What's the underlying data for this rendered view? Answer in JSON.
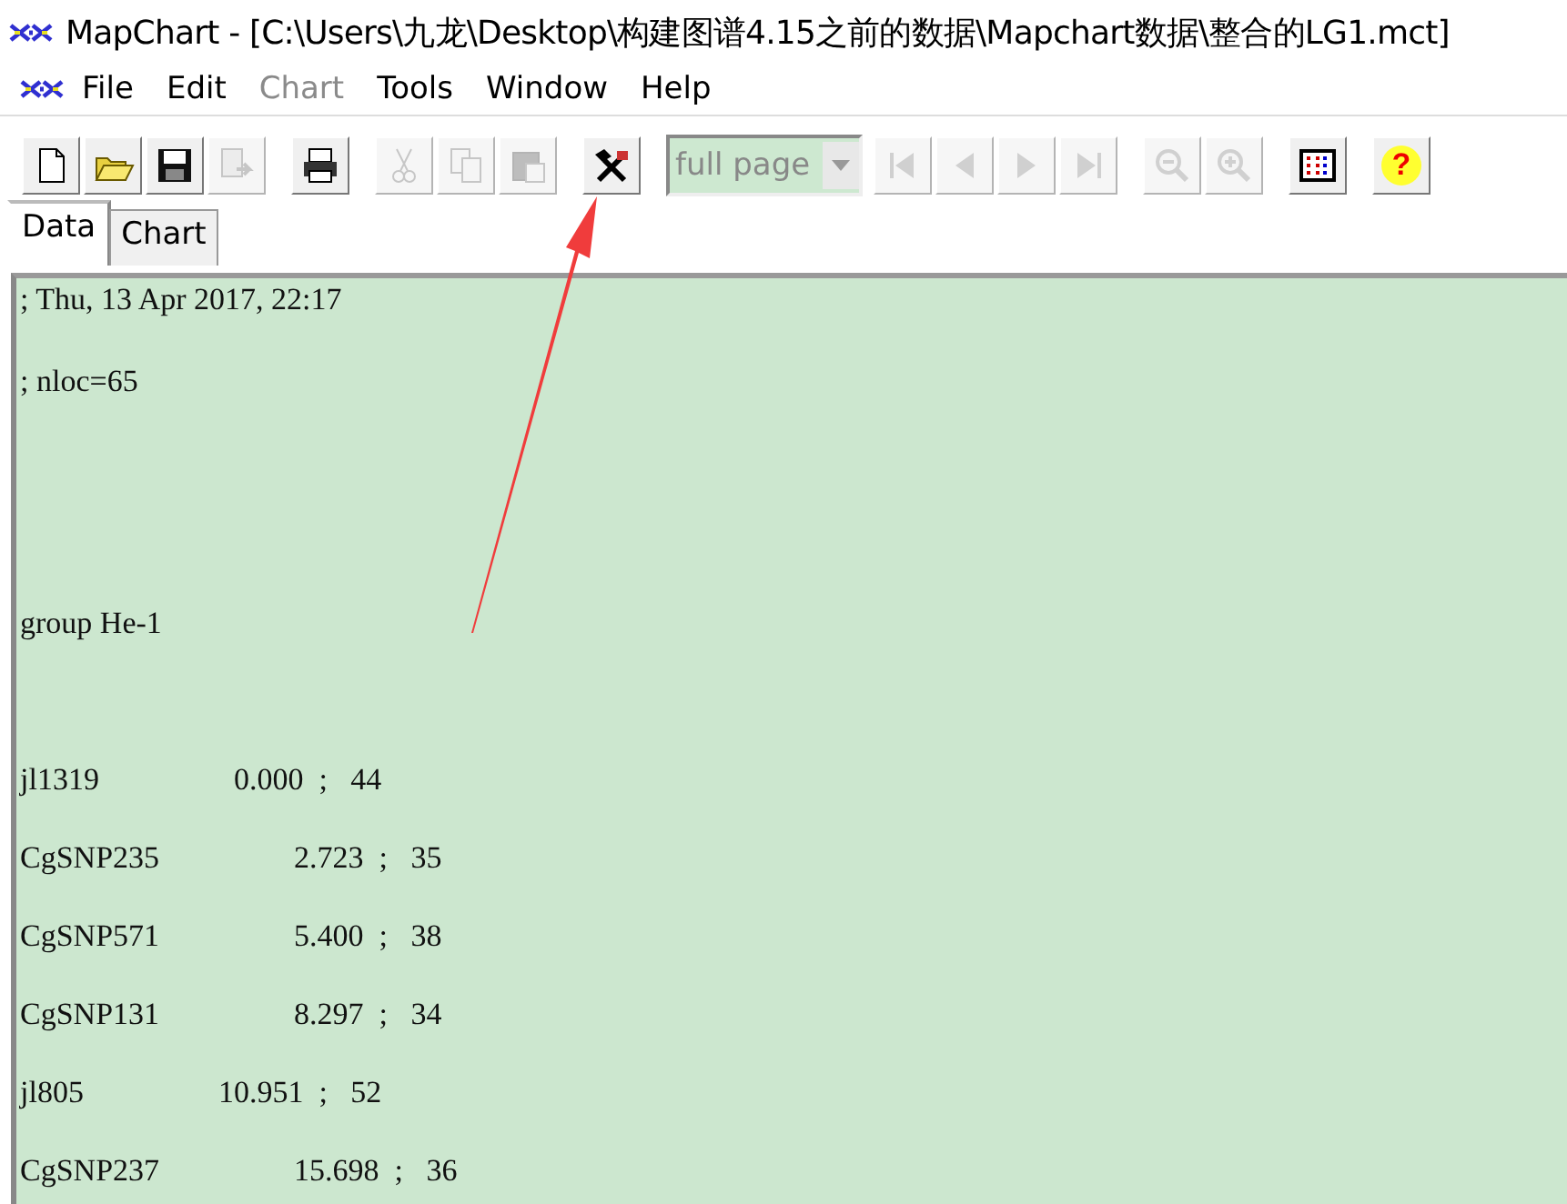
{
  "window": {
    "title": "MapChart - [C:\\Users\\九龙\\Desktop\\构建图谱4.15之前的数据\\Mapchart数据\\整合的LG1.mct]"
  },
  "menu": [
    {
      "label": "File",
      "disabled": false
    },
    {
      "label": "Edit",
      "disabled": false
    },
    {
      "label": "Chart",
      "disabled": true
    },
    {
      "label": "Tools",
      "disabled": false
    },
    {
      "label": "Window",
      "disabled": false
    },
    {
      "label": "Help",
      "disabled": false
    }
  ],
  "toolbar": [
    {
      "kind": "new",
      "disabled": false
    },
    {
      "kind": "open",
      "disabled": false
    },
    {
      "kind": "save",
      "disabled": false
    },
    {
      "kind": "export",
      "disabled": true
    },
    {
      "kind": "sep"
    },
    {
      "kind": "print",
      "disabled": false
    },
    {
      "kind": "sep"
    },
    {
      "kind": "cut",
      "disabled": true
    },
    {
      "kind": "copy",
      "disabled": true
    },
    {
      "kind": "paste",
      "disabled": true
    },
    {
      "kind": "sep"
    },
    {
      "kind": "tools",
      "disabled": false
    },
    {
      "kind": "sep"
    },
    {
      "kind": "dropdown",
      "value": "full page",
      "disabled": true
    },
    {
      "kind": "first",
      "disabled": true
    },
    {
      "kind": "prev",
      "disabled": true
    },
    {
      "kind": "next",
      "disabled": true
    },
    {
      "kind": "last",
      "disabled": true
    },
    {
      "kind": "sep"
    },
    {
      "kind": "zoomout",
      "disabled": true
    },
    {
      "kind": "zoomin",
      "disabled": true
    },
    {
      "kind": "sep"
    },
    {
      "kind": "colors",
      "disabled": false
    },
    {
      "kind": "sep"
    },
    {
      "kind": "help",
      "disabled": false,
      "label": "?"
    }
  ],
  "tabs": [
    {
      "label": "Data",
      "selected": true
    },
    {
      "label": "Chart",
      "selected": false
    }
  ],
  "editor": {
    "header_lines": [
      "; Thu, 13 Apr 2017, 22:17",
      "; nloc=65"
    ],
    "group": "group He-1",
    "markers": [
      {
        "name": "jl1319",
        "value": "0.000  ;   44"
      },
      {
        "name": "CgSNP235",
        "value": "2.723  ;   35"
      },
      {
        "name": "CgSNP571",
        "value": "5.400  ;   38"
      },
      {
        "name": "CgSNP131",
        "value": "8.297  ;   34"
      },
      {
        "name": "jl805",
        "value": "10.951  ;   52"
      },
      {
        "name": "CgSNP237",
        "value": "15.698  ;   36"
      }
    ]
  }
}
